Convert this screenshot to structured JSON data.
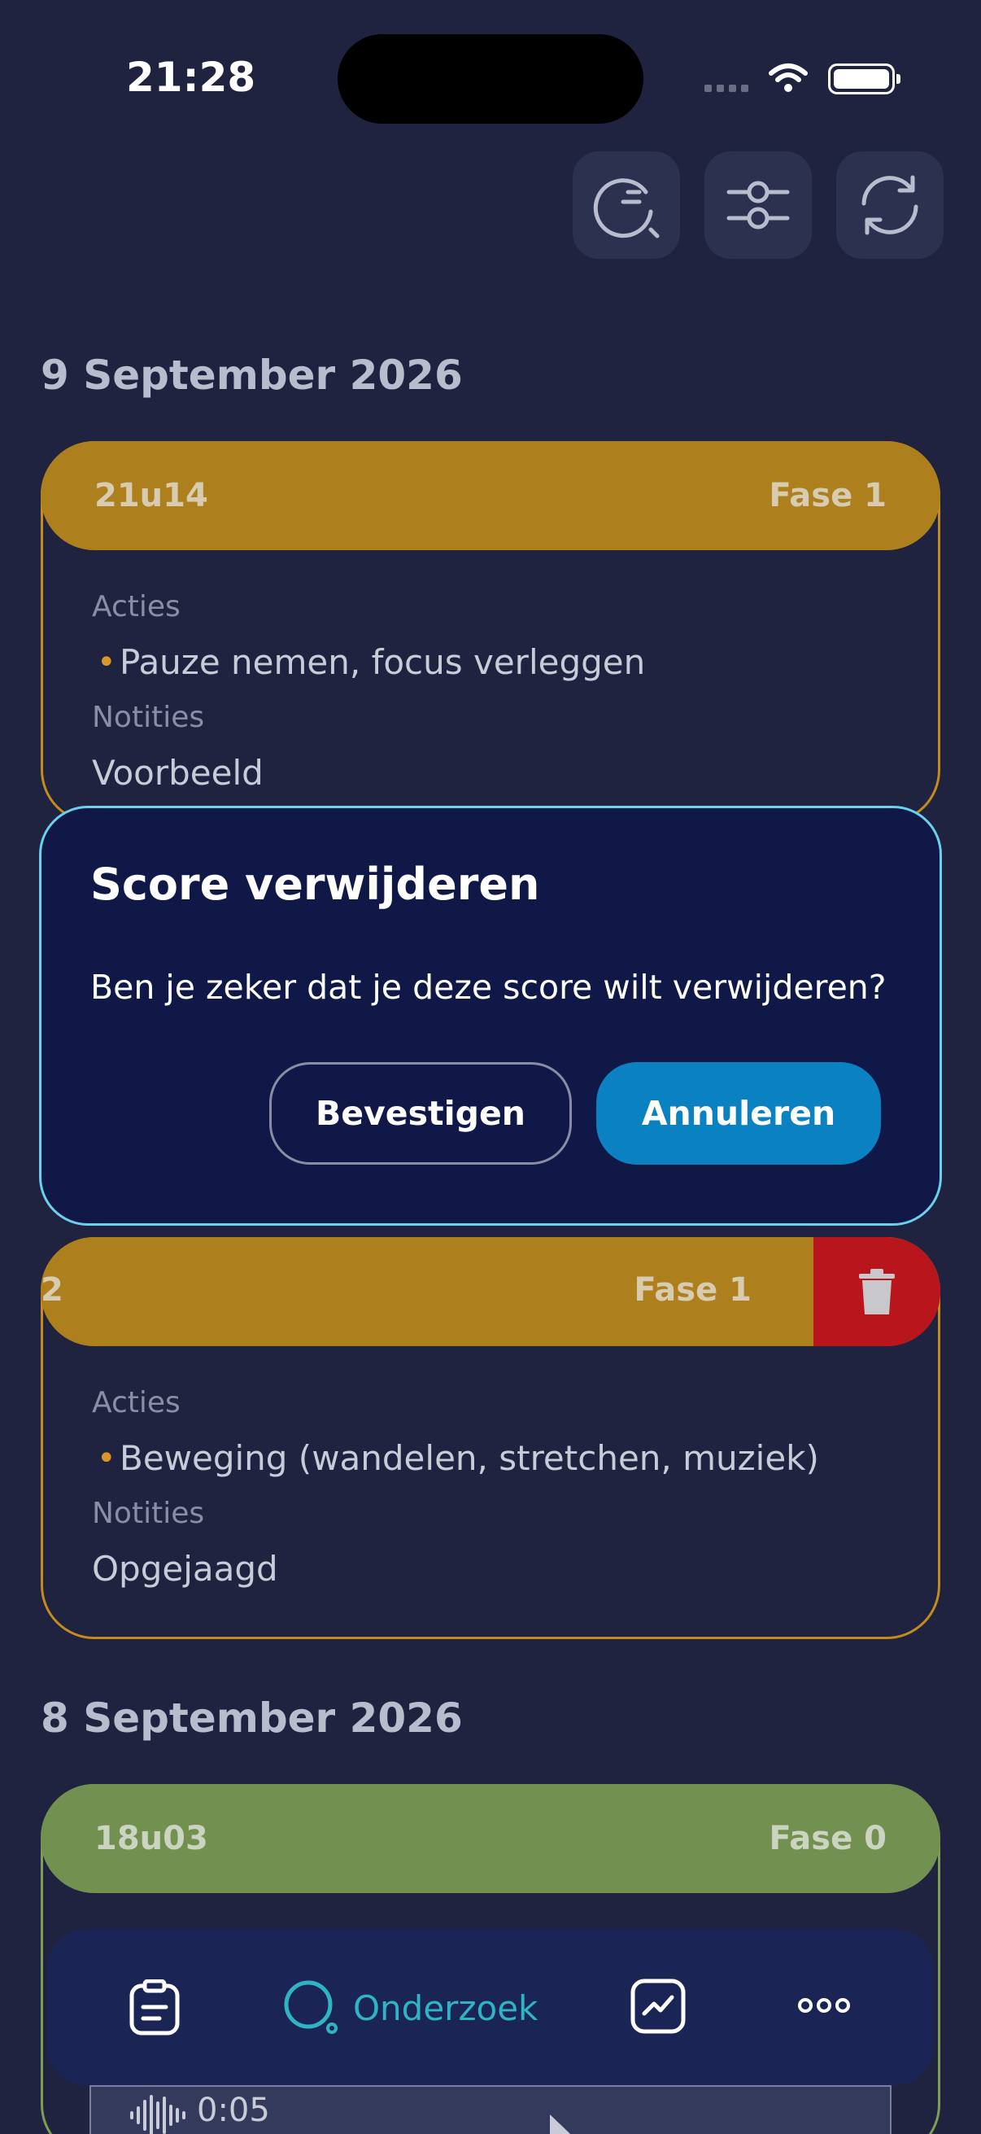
{
  "status_bar": {
    "time": "21:28"
  },
  "toolbar": {
    "icons": [
      "timer-search-icon",
      "sliders-icon",
      "refresh-icon"
    ]
  },
  "sections": [
    {
      "date": "9 September 2026",
      "cards": [
        {
          "time": "21u14",
          "phase": "Fase 1",
          "actions_label": "Acties",
          "action": "Pauze nemen, focus verleggen",
          "notes_label": "Notities",
          "note": "Voorbeeld"
        },
        {
          "time": "2",
          "phase": "Fase 1",
          "actions_label": "Acties",
          "action": "Beweging (wandelen, stretchen, muziek)",
          "notes_label": "Notities",
          "note": "Opgejaagd"
        }
      ]
    },
    {
      "date": "8 September 2026",
      "cards": [
        {
          "time": "18u03",
          "phase": "Fase 0",
          "audio_time": "0:05"
        }
      ]
    }
  ],
  "dialog": {
    "title": "Score verwijderen",
    "message": "Ben je zeker dat je deze score wilt verwijderen?",
    "confirm_label": "Bevestigen",
    "cancel_label": "Annuleren"
  },
  "bottom_nav": {
    "active_label": "Onderzoek",
    "items": [
      "clipboard-icon",
      "search-icon",
      "chart-icon",
      "more-icon"
    ]
  },
  "colors": {
    "background": "#1f2340",
    "phase1": "#ae7f1d",
    "phase0": "#72904f",
    "accent": "#0a82c2",
    "delete": "#b8151c",
    "active_nav": "#2fb4c4"
  }
}
